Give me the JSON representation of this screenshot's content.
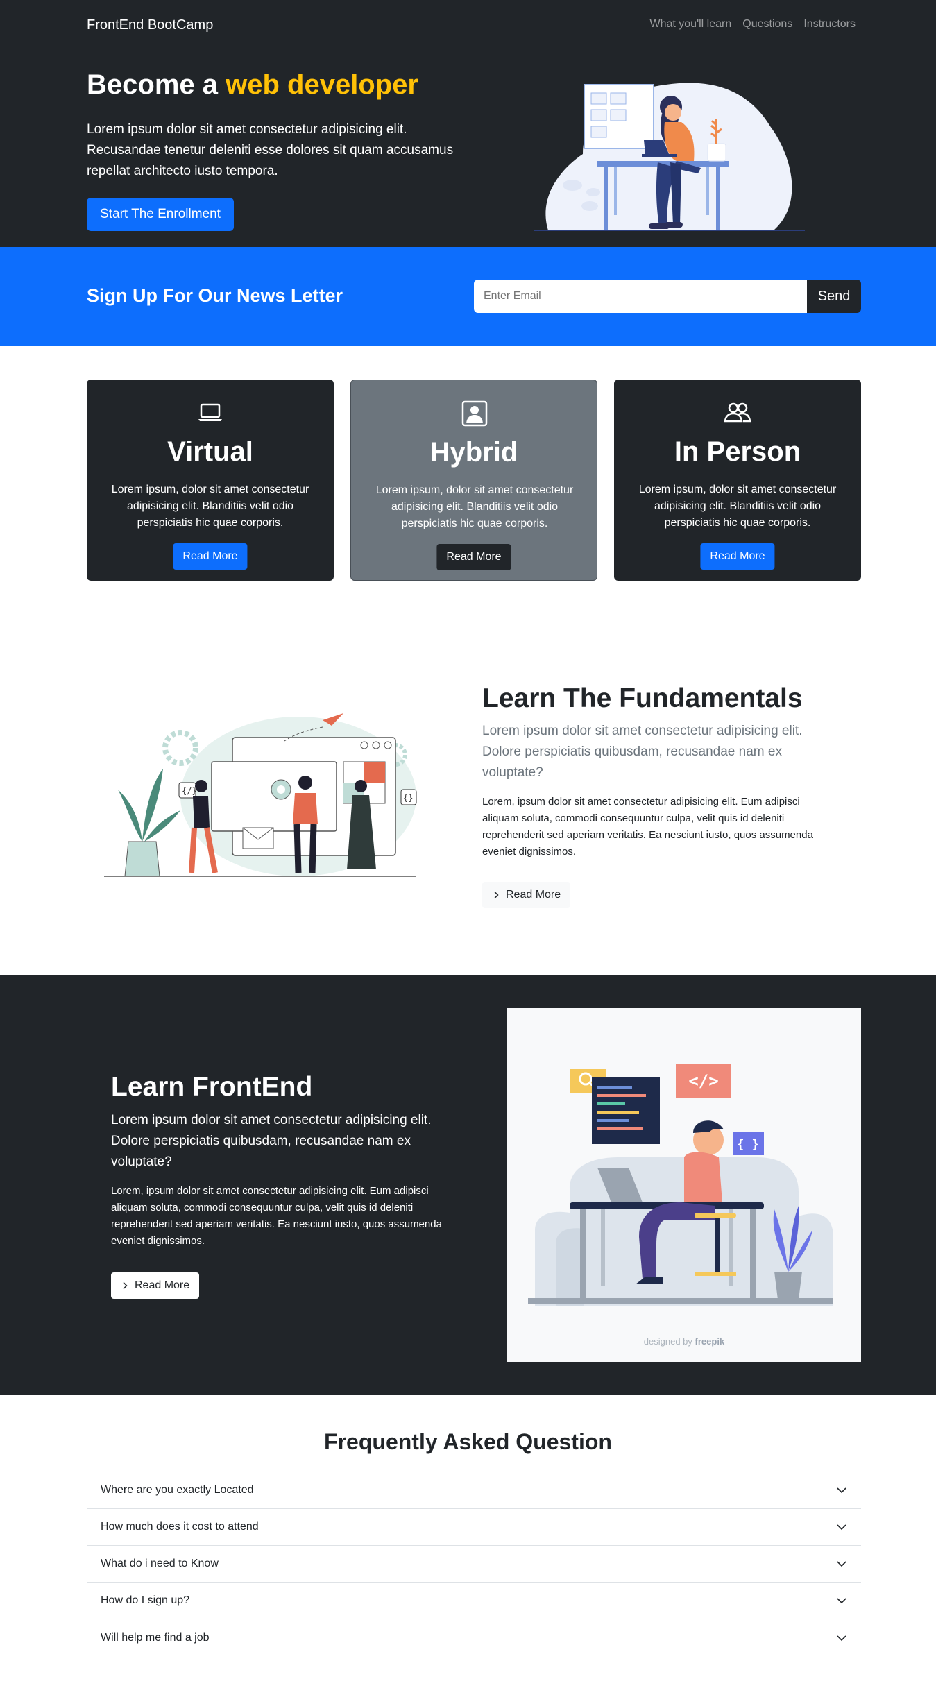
{
  "navbar": {
    "brand": "FrontEnd BootCamp",
    "links": [
      "What you'll learn",
      "Questions",
      "Instructors"
    ]
  },
  "hero": {
    "title_prefix": "Become a",
    "title_highlight": "web developer",
    "lead": "Lorem ipsum dolor sit amet consectetur adipisicing elit. Recusandae tenetur deleniti esse dolores sit quam accusamus repellat architecto iusto tempora.",
    "button": "Start The Enrollment"
  },
  "newsletter": {
    "title": "Sign Up For Our News Letter",
    "placeholder": "Enter Email",
    "button": "Send"
  },
  "cards": [
    {
      "icon": "laptop-icon",
      "title": "Virtual",
      "text": "Lorem ipsum, dolor sit amet consectetur adipisicing elit. Blanditiis velit odio perspiciatis hic quae corporis.",
      "button": "Read More"
    },
    {
      "icon": "person-square-icon",
      "title": "Hybrid",
      "text": "Lorem ipsum, dolor sit amet consectetur adipisicing elit. Blanditiis velit odio perspiciatis hic quae corporis.",
      "button": "Read More"
    },
    {
      "icon": "people-icon",
      "title": "In Person",
      "text": "Lorem ipsum, dolor sit amet consectetur adipisicing elit. Blanditiis velit odio perspiciatis hic quae corporis.",
      "button": "Read More"
    }
  ],
  "fundamentals": {
    "title": "Learn The Fundamentals",
    "lead": "Lorem ipsum dolor sit amet consectetur adipisicing elit. Dolore perspiciatis quibusdam, recusandae nam ex voluptate?",
    "text": "Lorem, ipsum dolor sit amet consectetur adipisicing elit. Eum adipisci aliquam soluta, commodi consequuntur culpa, velit quis id deleniti reprehenderit sed aperiam veritatis. Ea nesciunt iusto, quos assumenda eveniet dignissimos.",
    "button": "Read More"
  },
  "frontend": {
    "title": "Learn FrontEnd",
    "lead": "Lorem ipsum dolor sit amet consectetur adipisicing elit. Dolore perspiciatis quibusdam, recusandae nam ex voluptate?",
    "text": "Lorem, ipsum dolor sit amet consectetur adipisicing elit. Eum adipisci aliquam soluta, commodi consequuntur culpa, velit quis id deleniti reprehenderit sed aperiam veritatis. Ea nesciunt iusto, quos assumenda eveniet dignissimos.",
    "button": "Read More",
    "credit_prefix": "designed by",
    "credit_brand": "freepik"
  },
  "faq": {
    "title": "Frequently Asked Question",
    "items": [
      "Where are you exactly Located",
      "How much does it cost to attend",
      "What do i need to Know",
      "How do I sign up?",
      "Will help me find a job"
    ]
  },
  "colors": {
    "dark": "#212529",
    "primary": "#0d6efd",
    "warning": "#ffc107",
    "secondary": "#6c757d"
  }
}
